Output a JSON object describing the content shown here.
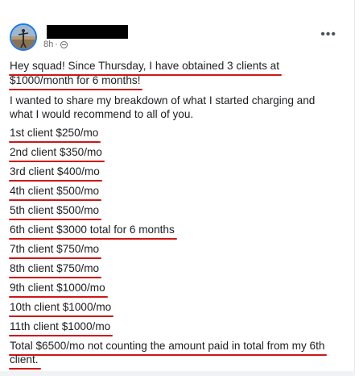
{
  "post": {
    "time": "8h",
    "separator": "·",
    "more_label": "•••",
    "intro_line1": "Hey squad! Since Thursday, I have obtained 3 clients at",
    "intro_line2": "$1000/month for 6 months!",
    "para_line1": "I wanted to share my breakdown of what I started charging and",
    "para_line2": "what I would recommend to all of you.",
    "items": [
      "1st client $250/mo",
      "2nd client $350/mo",
      "3rd client $400/mo",
      "4th client $500/mo",
      "5th client $500/mo",
      "6th client $3000 total for 6 months",
      "7th client $750/mo",
      "8th client $750/mo",
      "9th client $1000/mo",
      "10th client $1000/mo",
      "11th client $1000/mo"
    ],
    "total_line1": "Total $6500/mo not counting the amount paid in total from my 6th",
    "total_line2": "client."
  },
  "colors": {
    "underline": "#d01616",
    "avatar_ring": "#1877f2"
  }
}
